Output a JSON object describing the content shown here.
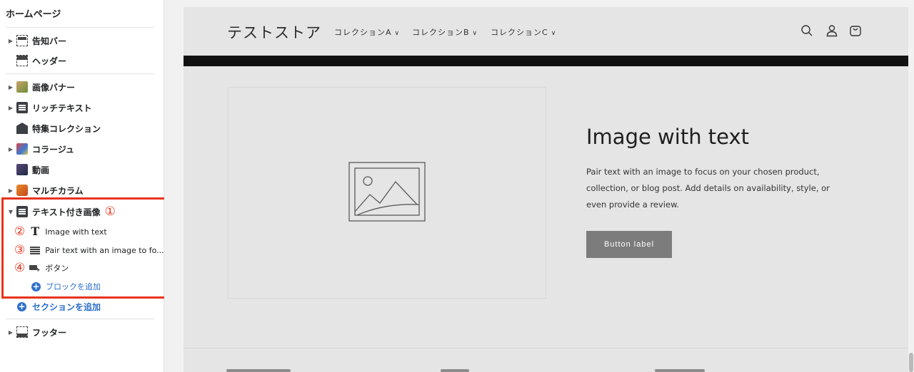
{
  "sidebar": {
    "title": "ホームページ",
    "items": {
      "announcement": "告知バー",
      "header": "ヘッダー",
      "banner": "画像バナー",
      "rich_text": "リッチテキスト",
      "featured": "特集コレクション",
      "collage": "コラージュ",
      "video": "動画",
      "multicolumn": "マルチカラム",
      "image_with_text": "テキスト付き画像",
      "block_heading": "Image with text",
      "block_text": "Pair text with an image to fo...",
      "block_button": "ボタン",
      "add_block": "ブロックを追加",
      "add_section": "セクションを追加",
      "footer": "フッター"
    },
    "markers": {
      "m1": "①",
      "m2": "②",
      "m3": "③",
      "m4": "④"
    },
    "plus": "+"
  },
  "store": {
    "name": "テストストア",
    "nav": [
      "コレクションA",
      "コレクションB",
      "コレクションC"
    ],
    "chevron": "∨"
  },
  "image_with_text": {
    "heading": "Image with text",
    "body": "Pair text with an image to focus on your chosen product, collection, or blog post. Add details on availability, style, or even provide a review.",
    "button": "Button label"
  },
  "colors": {
    "highlight": "#e8321c",
    "link": "#2c6ecb",
    "button": "#7c7c7c"
  }
}
